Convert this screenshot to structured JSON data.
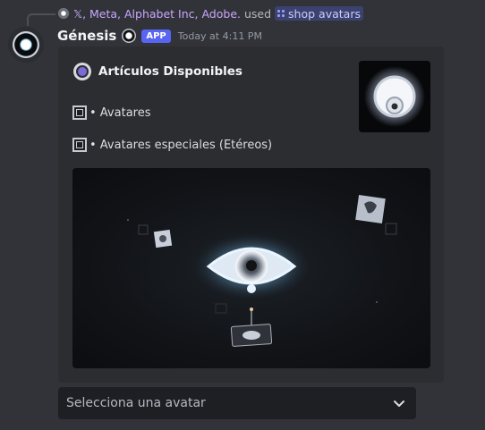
{
  "reply": {
    "names": "𝕏, Meta, Alphabet Inc, Adobe.",
    "used": "used",
    "command": "shop avatars"
  },
  "author": {
    "name": "Génesis",
    "badge": "APP",
    "timestamp": "Today at 4:11 PM"
  },
  "embed": {
    "title": "Artículos Disponibles",
    "fields": [
      {
        "label": "• Avatares"
      },
      {
        "label": "• Avatares especiales (Etéreos)"
      }
    ]
  },
  "select_menu": {
    "placeholder": "Selecciona una avatar"
  },
  "icons": {
    "reply_avatar": "user-avatar-icon",
    "command": "slash-command-icon",
    "verified": "app-icon",
    "title": "circle-icon",
    "field": "square-icon",
    "dropdown": "chevron-down-icon"
  },
  "colors": {
    "background": "#313338",
    "embed_background": "#2b2d31",
    "app_badge": "#5865f2",
    "command_chip": "#3c4270",
    "select_background": "#1e1f22"
  }
}
